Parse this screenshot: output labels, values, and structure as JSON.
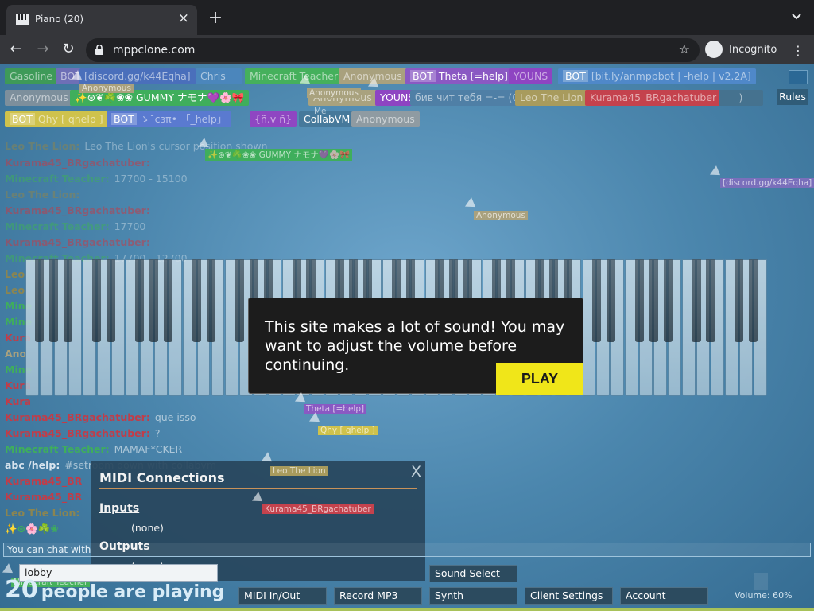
{
  "browser": {
    "tab_title": "Piano (20)",
    "new_tab_glyph": "+",
    "url": "mppclone.com",
    "incognito_label": "Incognito",
    "menu_glyph": "⋮"
  },
  "users": [
    {
      "name": "Gasoline",
      "color": "#3e9a58"
    },
    {
      "name": "BOT",
      "color": "#6e6fb6"
    },
    {
      "name": "[discord.gg/k44Eqha]",
      "color": "#4a6fbb"
    },
    {
      "name": "Chris",
      "color": "#4b86bc"
    },
    {
      "name": "Minecraft Teacher",
      "color": "#45b05c"
    },
    {
      "name": "Anonymous",
      "color": "#a9a17e"
    },
    {
      "name": "Theta [=help]",
      "color": "#8a59c3",
      "bot": true
    },
    {
      "name": "YOUNS",
      "color": "#8e44c2"
    },
    {
      "name": "[bit.ly/anmppbot | -help | v2.2A]",
      "color": "#4f88c9",
      "bot": true
    },
    {
      "name": "Anonymous",
      "color": "#7d8f9c"
    },
    {
      "name": "✨⊛❦☘️❀❀ GUMMY ナモナ💜🌸🎀",
      "color": "#3fae5c"
    },
    {
      "name": "Anonymous",
      "color": "#a9a27e"
    },
    {
      "name": "YOUNS",
      "color": "#8e44c2"
    },
    {
      "name": "бив чит тебя =-= (0_=)",
      "color": "#4f7fa6"
    },
    {
      "name": "Leo The Lion",
      "color": "#a89b5d"
    },
    {
      "name": "Kurama45_BRgachatuber",
      "color": "#c4424d"
    },
    {
      "name": ")",
      "color": "#45728f"
    },
    {
      "name": "Qhy [ qhelp ]",
      "color": "#cfc24c",
      "bot": true
    },
    {
      "name": "ゝ˘сзπ• 「_help」",
      "color": "#5a7ad0",
      "bot": true
    },
    {
      "name": "{ñ.v ñ}",
      "color": "#8f46c2"
    },
    {
      "name": "CollabVM",
      "color": "#46799b"
    },
    {
      "name": "Anonymous",
      "color": "#8f9ba2"
    }
  ],
  "rules_label": "Rules",
  "chat": [
    {
      "name": "Leo The Lion:",
      "msg": "Leo The Lion's cursor position shown",
      "color": "#8b8551"
    },
    {
      "name": "Kurama45_BRgachatuber:",
      "msg": "",
      "color": "#c23c48"
    },
    {
      "name": "Minecraft Teacher:",
      "msg": "17700 - 15100",
      "color": "#3fae5c"
    },
    {
      "name": "Leo The Lion:",
      "msg": "",
      "color": "#8b8551"
    },
    {
      "name": "Kurama45_BRgachatuber:",
      "msg": "",
      "color": "#c23c48"
    },
    {
      "name": "Minecraft Teacher:",
      "msg": "17700",
      "color": "#3fae5c"
    },
    {
      "name": "Kurama45_BRgachatuber:",
      "msg": "",
      "color": "#c23c48"
    },
    {
      "name": "Minecraft Teacher:",
      "msg": "17700 - 12700",
      "color": "#3fae5c"
    },
    {
      "name": "Leo",
      "msg": "",
      "color": "#8b8551"
    },
    {
      "name": "Leo",
      "msg": "",
      "color": "#8b8551"
    },
    {
      "name": "Mine",
      "msg": "",
      "color": "#3fae5c"
    },
    {
      "name": "Mine",
      "msg": "",
      "color": "#3fae5c"
    },
    {
      "name": "Kura",
      "msg": "",
      "color": "#c23c48"
    },
    {
      "name": "Ano",
      "msg": "",
      "color": "#a9a17e"
    },
    {
      "name": "Mine",
      "msg": "",
      "color": "#3fae5c"
    },
    {
      "name": "Kura",
      "msg": "",
      "color": "#c23c48"
    },
    {
      "name": "Kura",
      "msg": "",
      "color": "#c23c48"
    },
    {
      "name": "Kurama45_BRgachatuber:",
      "msg": "que isso",
      "color": "#c23c48"
    },
    {
      "name": "Kurama45_BRgachatuber:",
      "msg": "?",
      "color": "#c23c48"
    },
    {
      "name": "Minecraft Teacher:",
      "msg": "MAMAF*CKER",
      "color": "#3fae5c"
    },
    {
      "name": "abc /help:",
      "msg": "#setroom down with collabvm",
      "color": "#d8e4ee"
    },
    {
      "name": "Kurama45_BR",
      "msg": "",
      "color": "#c23c48"
    },
    {
      "name": "Kurama45_BR",
      "msg": "",
      "color": "#c23c48"
    },
    {
      "name": "Leo The Lion:",
      "msg": "",
      "color": "#8b8551"
    },
    {
      "name": "✨⊛🌸☘️❀",
      "msg": "",
      "color": "#3fae5c"
    }
  ],
  "sound_modal": {
    "text": "This site makes a lot of sound! You may want to adjust the volume before continuing.",
    "play_label": "PLAY"
  },
  "midi": {
    "title": "MIDI Connections",
    "close": "X",
    "inputs_label": "Inputs",
    "inputs_value": "(none)",
    "outputs_label": "Outputs",
    "outputs_value": "(none)"
  },
  "cursors": [
    {
      "name": "Anonymous",
      "color": "#a9a17e"
    },
    {
      "name": "Anonymous",
      "color": "#a9a27e"
    },
    {
      "name": "Me",
      "color": "transparent"
    },
    {
      "name": "✨⊛❦☘️❀❀ GUMMY ナモナ💜🌸🎀",
      "color": "#3fae5c"
    },
    {
      "name": "[discord.gg/k44Eqha]",
      "color": "#7a6fbb"
    },
    {
      "name": "Anonymous",
      "color": "#a9a17e"
    },
    {
      "name": "Theta [=help]",
      "color": "#8a59c3"
    },
    {
      "name": "Qhy [ qhelp ]",
      "color": "#cfc24c"
    },
    {
      "name": "Leo The Lion",
      "color": "#a89b5d"
    },
    {
      "name": "Kurama45_BRgachatuber",
      "color": "#c4424d"
    },
    {
      "name": "Minecraft Teacher",
      "color": "#45b05c"
    }
  ],
  "chat_placeholder": "You can chat with",
  "room": "lobby",
  "people": {
    "count": "20",
    "label": "people are playing"
  },
  "controls": {
    "midi": "MIDI In/Out",
    "record": "Record MP3",
    "sound_select": "Sound Select",
    "synth": "Synth",
    "client_settings": "Client Settings",
    "account": "Account"
  },
  "volume": "Volume: 60%"
}
